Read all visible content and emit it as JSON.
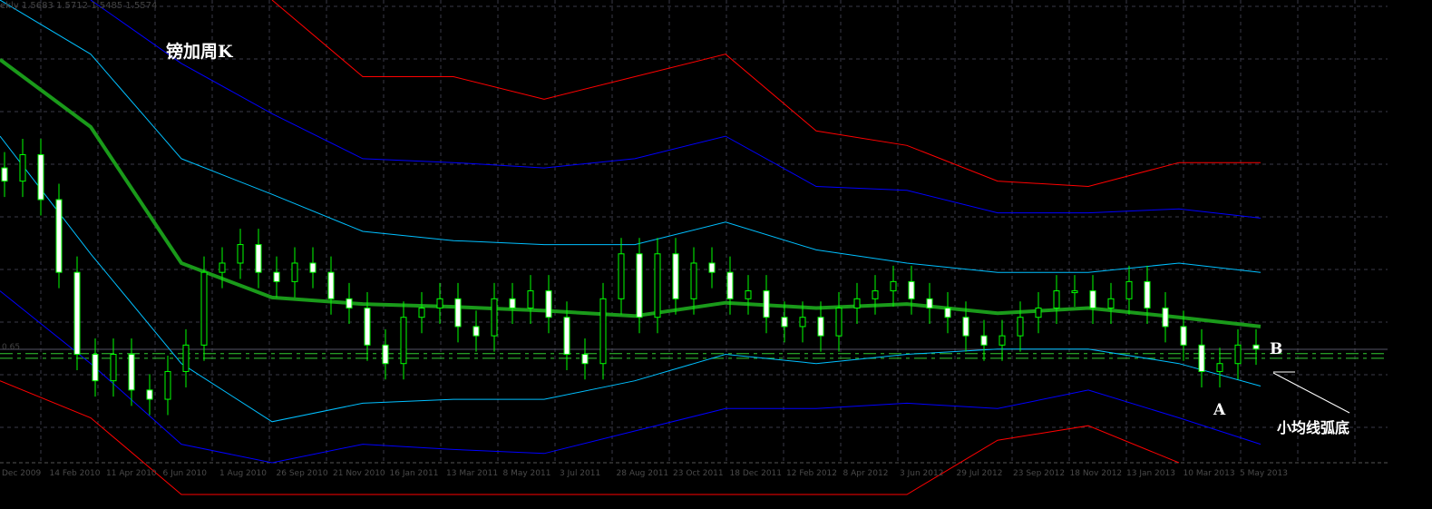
{
  "header": {
    "symbol_suffix": "ekly",
    "ohlc": [
      "1.5683",
      "1.5712",
      "1.5485",
      "1.5574"
    ]
  },
  "price_labels": [
    "0.65"
  ],
  "annotations": {
    "title": "镑加周K",
    "point_a": "A",
    "point_b": "B",
    "note": "小均线弧底"
  },
  "colors": {
    "bull": "#00ff00",
    "ma": "#1a9a1a",
    "cyan": "#00bfff",
    "blue": "#0000ff",
    "red": "#ff0000",
    "grid": "#3a3a48",
    "level": "#33cc33"
  },
  "chart_data": {
    "type": "candlestick",
    "title": "镑加周K",
    "ylim": [
      1.4,
      1.75
    ],
    "x_tick_labels": [
      "Dec 2009",
      "14 Feb 2010",
      "11 Apr 2010",
      "6 Jun 2010",
      "1 Aug 2010",
      "26 Sep 2010",
      "21 Nov 2010",
      "16 Jan 2011",
      "13 Mar 2011",
      "8 May 2011",
      "3 Jul 2011",
      "28 Aug 2011",
      "23 Oct 2011",
      "18 Dec 2011",
      "12 Feb 2012",
      "8 Apr 2012",
      "3 Jun 2012",
      "29 Jul 2012",
      "23 Sep 2012",
      "18 Nov 2012",
      "13 Jan 2013",
      "10 Mar 2013",
      "5 May 2013"
    ],
    "closes": [
      1.613,
      1.633,
      1.599,
      1.544,
      1.482,
      1.462,
      1.482,
      1.455,
      1.448,
      1.469,
      1.489,
      1.544,
      1.551,
      1.565,
      1.544,
      1.537,
      1.551,
      1.544,
      1.524,
      1.517,
      1.489,
      1.475,
      1.51,
      1.517,
      1.524,
      1.503,
      1.496,
      1.524,
      1.517,
      1.53,
      1.51,
      1.482,
      1.475,
      1.524,
      1.558,
      1.51,
      1.558,
      1.524,
      1.551,
      1.544,
      1.524,
      1.53,
      1.51,
      1.503,
      1.51,
      1.496,
      1.517,
      1.524,
      1.53,
      1.537,
      1.524,
      1.517,
      1.51,
      1.496,
      1.489,
      1.496,
      1.51,
      1.517,
      1.53,
      1.53,
      1.517,
      1.524,
      1.537,
      1.517,
      1.503,
      1.489,
      1.469,
      1.475,
      1.489,
      1.486
    ],
    "series": [
      {
        "name": "moving-average",
        "color": "ma",
        "width": 4,
        "values": [
          1.705,
          1.654,
          1.551,
          1.525,
          1.52,
          1.518,
          1.515,
          1.511,
          1.521,
          1.517,
          1.52,
          1.513,
          1.517,
          1.51,
          1.503
        ]
      },
      {
        "name": "red-upper-band",
        "color": "red",
        "width": 1,
        "values": [
          null,
          null,
          null,
          1.757,
          1.692,
          1.692,
          1.675,
          1.692,
          1.709,
          1.651,
          1.64,
          1.613,
          1.609,
          1.627,
          1.627
        ]
      },
      {
        "name": "blue-upper-band",
        "color": "blue",
        "width": 1,
        "values": [
          null,
          1.757,
          1.702,
          1.664,
          1.63,
          1.627,
          1.623,
          1.63,
          1.647,
          1.609,
          1.606,
          1.589,
          1.589,
          1.592,
          1.585
        ]
      },
      {
        "name": "cyan-upper-band",
        "color": "cyan",
        "width": 1,
        "values": [
          1.791,
          1.709,
          1.63,
          1.603,
          1.575,
          1.568,
          1.565,
          1.565,
          1.582,
          1.561,
          1.551,
          1.544,
          1.544,
          1.551,
          1.544
        ]
      },
      {
        "name": "cyan-lower-band",
        "color": "cyan",
        "width": 1,
        "values": [
          1.647,
          1.558,
          1.475,
          1.431,
          1.445,
          1.448,
          1.448,
          1.462,
          1.482,
          1.475,
          1.482,
          1.486,
          1.486,
          1.475,
          1.458
        ]
      },
      {
        "name": "blue-lower-band",
        "color": "blue",
        "width": 1,
        "values": [
          1.53,
          1.475,
          1.414,
          1.4,
          1.414,
          1.41,
          1.407,
          1.424,
          1.441,
          1.441,
          1.445,
          1.441,
          1.455,
          1.434,
          1.414
        ]
      },
      {
        "name": "red-lower-band",
        "color": "red",
        "width": 1,
        "values": [
          1.462,
          1.434,
          1.366,
          1.3,
          1.3,
          1.3,
          1.3,
          1.3,
          1.3,
          1.3,
          1.366,
          1.417,
          1.428,
          1.4,
          null
        ]
      }
    ],
    "levels": [
      1.4825,
      1.479
    ],
    "grid": true
  }
}
